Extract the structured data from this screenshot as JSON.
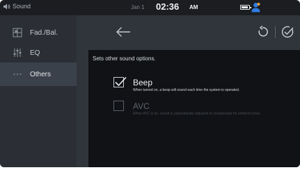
{
  "status": {
    "app_label": "Sound",
    "date": "Jan 1",
    "time": "02:36",
    "ampm": "AM"
  },
  "sidebar": {
    "items": [
      {
        "label": "Fad./Bal.",
        "icon": "fader-balance-icon"
      },
      {
        "label": "EQ",
        "icon": "equalizer-icon"
      },
      {
        "label": "Others",
        "icon": "more-dots-icon",
        "active": true
      }
    ]
  },
  "header": {
    "back_icon": "arrow-left-icon",
    "reset_icon": "reset-icon",
    "confirm_icon": "check-circle-icon"
  },
  "panel": {
    "description": "Sets other sound options.",
    "options": [
      {
        "title": "Beep",
        "description": "When turned on, a beep will sound each time the system is operated.",
        "checked": true,
        "enabled": true
      },
      {
        "title": "AVC",
        "description": "When AVC is on, sound is automatically adjusted to compensate for ambient noise.",
        "checked": false,
        "enabled": false
      }
    ]
  },
  "colors": {
    "background": "#23262b",
    "sidebar": "#2b2f35",
    "sidebar_active": "#3a414a",
    "panel": "#101215",
    "accent_profile": "#2f7de1"
  }
}
